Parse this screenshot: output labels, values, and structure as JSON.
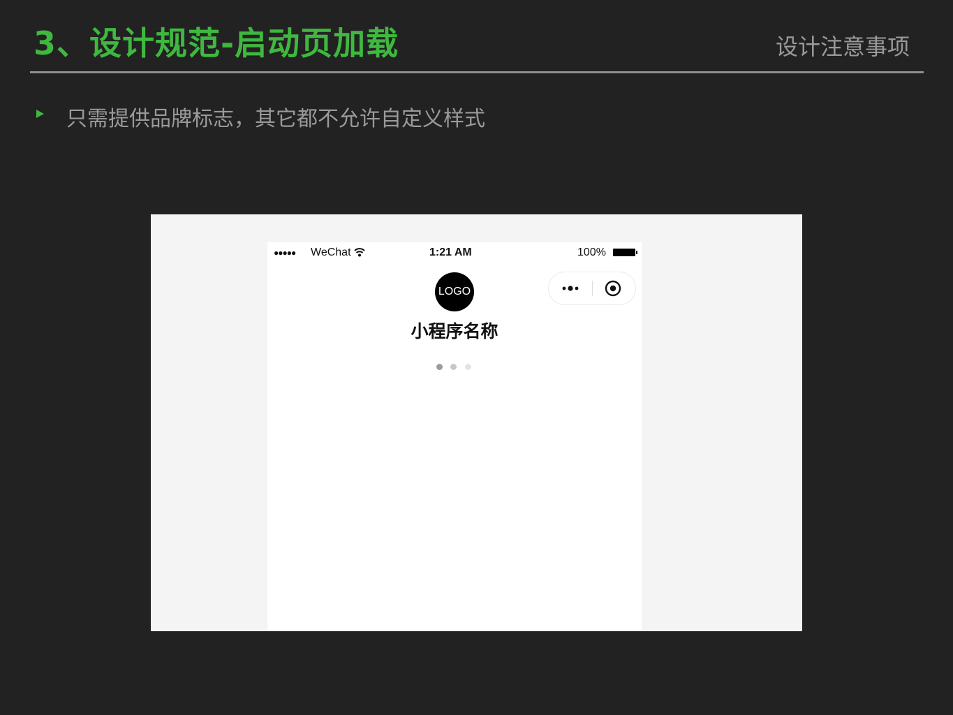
{
  "slide": {
    "title": "3、设计规范-启动页加载",
    "subtitle": "设计注意事项",
    "bullet": "只需提供品牌标志，其它都不允许自定义样式"
  },
  "colors": {
    "accent": "#3fb83f",
    "background": "#222222",
    "muted_text": "#9a9a9a"
  },
  "phone": {
    "status_bar": {
      "signal_dots": "●●●●●",
      "carrier": "WeChat",
      "wifi_icon": "wifi-icon",
      "time": "1:21 AM",
      "battery": "100%",
      "battery_icon": "battery-icon"
    },
    "capsule": {
      "more_icon": "more-dots-icon",
      "close_icon": "target-close-icon"
    },
    "logo_text": "LOGO",
    "app_name": "小程序名称",
    "loading_dots": {
      "count": 3,
      "colors": [
        "#9b9b9b",
        "#c8c8c8",
        "#e4e4e4"
      ]
    }
  }
}
